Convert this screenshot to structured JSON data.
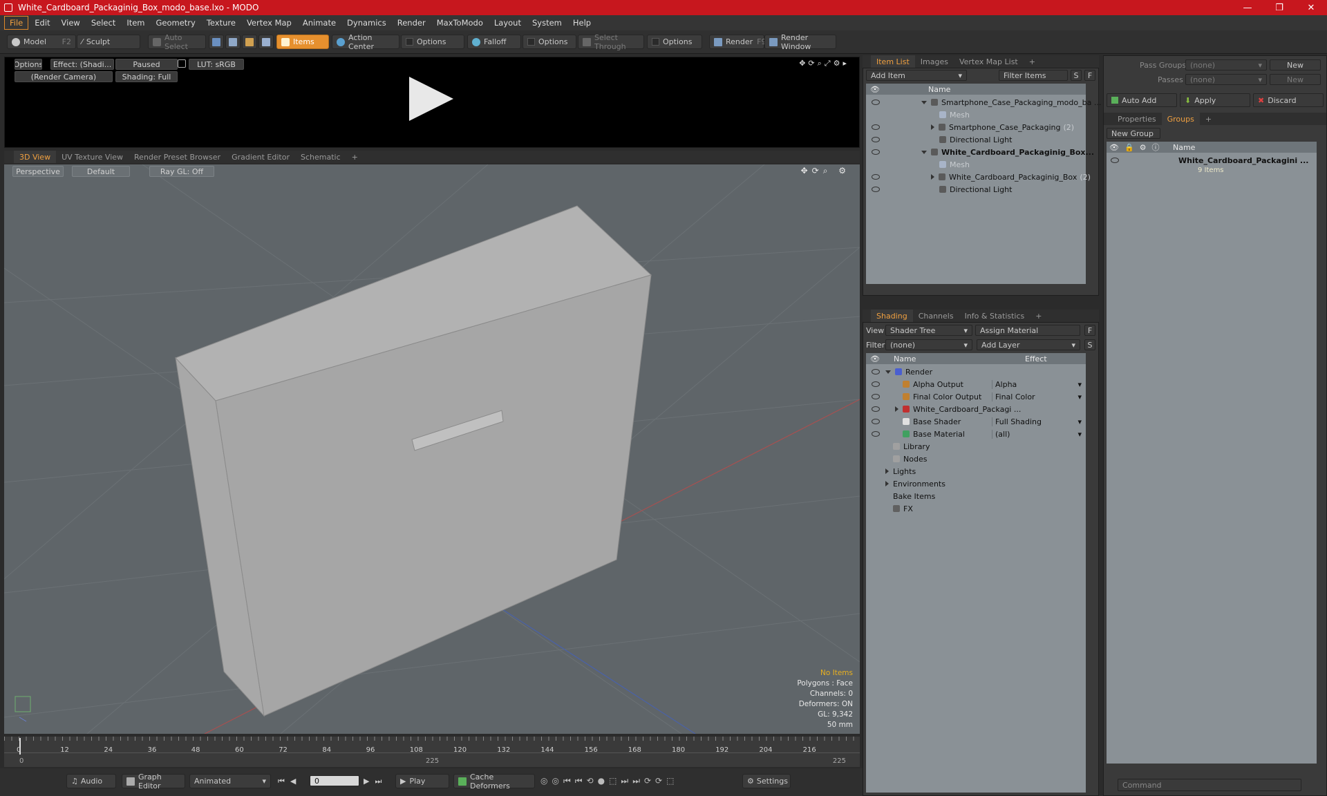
{
  "window": {
    "title": "White_Cardboard_Packaginig_Box_modo_base.lxo - MODO",
    "min": "—",
    "max": "❐",
    "close": "✕"
  },
  "menu": [
    "File",
    "Edit",
    "View",
    "Select",
    "Item",
    "Geometry",
    "Texture",
    "Vertex Map",
    "Animate",
    "Dynamics",
    "Render",
    "MaxToModo",
    "Layout",
    "System",
    "Help"
  ],
  "toolbar": {
    "model": "Model",
    "model_key": "F2",
    "sculpt": "Sculpt",
    "auto_select": "Auto Select",
    "items": "Items",
    "action_center": "Action Center",
    "options1": "Options",
    "falloff": "Falloff",
    "options2": "Options",
    "select_through": "Select Through",
    "options3": "Options",
    "render": "Render",
    "render_key": "F9",
    "render_window": "Render Window"
  },
  "render_preview": {
    "options": "Options",
    "effect": "Effect: (Shadi...",
    "paused": "Paused",
    "lut": "LUT: sRGB",
    "camera": "(Render Camera)",
    "shading": "Shading: Full"
  },
  "viewport_tabs": [
    "3D View",
    "UV Texture View",
    "Render Preset Browser",
    "Gradient Editor",
    "Schematic",
    "+"
  ],
  "viewport": {
    "perspective": "Perspective",
    "default": "Default",
    "raygl": "Ray GL: Off",
    "hud": {
      "no_items": "No Items",
      "polygons": "Polygons : Face",
      "channels": "Channels: 0",
      "deformers": "Deformers: ON",
      "gl": "GL: 9,342",
      "focal": "50 mm"
    }
  },
  "timeline": {
    "ticks": [
      "0",
      "12",
      "24",
      "36",
      "48",
      "60",
      "72",
      "84",
      "96",
      "108",
      "120",
      "132",
      "144",
      "156",
      "168",
      "180",
      "192",
      "204",
      "216"
    ],
    "start": "0",
    "mid": "225",
    "end": "225"
  },
  "bottom_bar": {
    "audio": "Audio",
    "graph_editor": "Graph Editor",
    "animated": "Animated",
    "frame": "0",
    "play": "Play",
    "cache": "Cache Deformers",
    "settings": "Settings"
  },
  "item_list": {
    "tabs": [
      "Item List",
      "Images",
      "Vertex Map List",
      "+"
    ],
    "add_item": "Add Item",
    "filter_items": "Filter Items",
    "s": "S",
    "f": "F",
    "name_col": "Name",
    "rows": [
      {
        "label": "Smartphone_Case_Packaging_modo_ba ...",
        "indent": 0,
        "bold": false,
        "dim": false,
        "tri": "down"
      },
      {
        "label": "Mesh",
        "indent": 1,
        "bold": false,
        "dim": true,
        "tri": ""
      },
      {
        "label": "Smartphone_Case_Packaging",
        "count": "(2)",
        "indent": 1,
        "bold": false,
        "dim": false,
        "tri": "right"
      },
      {
        "label": "Directional Light",
        "indent": 1,
        "bold": false,
        "dim": false,
        "tri": ""
      },
      {
        "label": "White_Cardboard_Packaginig_Box...",
        "indent": 0,
        "bold": true,
        "dim": false,
        "tri": "down"
      },
      {
        "label": "Mesh",
        "indent": 1,
        "bold": false,
        "dim": true,
        "tri": ""
      },
      {
        "label": "White_Cardboard_Packaginig_Box",
        "count": "(2)",
        "indent": 1,
        "bold": false,
        "dim": false,
        "tri": "right"
      },
      {
        "label": "Directional Light",
        "indent": 1,
        "bold": false,
        "dim": false,
        "tri": ""
      }
    ]
  },
  "shading": {
    "tabs": [
      "Shading",
      "Channels",
      "Info & Statistics",
      "+"
    ],
    "view_label": "View",
    "view_value": "Shader Tree",
    "assign_material": "Assign Material",
    "filter_label": "Filter",
    "filter_value": "(none)",
    "add_layer": "Add Layer",
    "f": "F",
    "s": "S",
    "name_col": "Name",
    "effect_col": "Effect",
    "rows": [
      {
        "label": "Render",
        "effect": "",
        "indent": 0,
        "tri": "down",
        "color": "#4a5fd0"
      },
      {
        "label": "Alpha Output",
        "effect": "Alpha",
        "indent": 1,
        "tri": "",
        "color": "#c08030"
      },
      {
        "label": "Final Color Output",
        "effect": "Final Color",
        "indent": 1,
        "tri": "",
        "color": "#c08030"
      },
      {
        "label": "White_Cardboard_Packagi ...",
        "effect": "",
        "indent": 1,
        "tri": "right",
        "color": "#c03030"
      },
      {
        "label": "Base Shader",
        "effect": "Full Shading",
        "indent": 1,
        "tri": "",
        "color": "#e0e0e0"
      },
      {
        "label": "Base Material",
        "effect": "(all)",
        "indent": 1,
        "tri": "",
        "color": "#40a060"
      },
      {
        "label": "Library",
        "effect": "",
        "indent": 0,
        "tri": "",
        "color": "#a0a0a0"
      },
      {
        "label": "Nodes",
        "effect": "",
        "indent": 0,
        "tri": "",
        "color": "#a0a0a0"
      },
      {
        "label": "Lights",
        "effect": "",
        "indent": 0,
        "tri": "right",
        "color": ""
      },
      {
        "label": "Environments",
        "effect": "",
        "indent": 0,
        "tri": "right",
        "color": ""
      },
      {
        "label": "Bake Items",
        "effect": "",
        "indent": 0,
        "tri": "",
        "color": ""
      },
      {
        "label": "FX",
        "effect": "",
        "indent": 0,
        "tri": "",
        "color": "#606060"
      }
    ]
  },
  "groups": {
    "pass_groups_label": "Pass Groups",
    "pass_groups_value": "(none)",
    "new1": "New",
    "passes_label": "Passes",
    "passes_value": "(none)",
    "new2": "New",
    "auto_add": "Auto Add",
    "apply": "Apply",
    "discard": "Discard",
    "tabs": [
      "Properties",
      "Groups",
      "+"
    ],
    "new_group": "New Group",
    "name_col": "Name",
    "group_name": "White_Cardboard_Packagini ...",
    "group_count": "9 Items"
  },
  "command": {
    "placeholder": "Command"
  }
}
